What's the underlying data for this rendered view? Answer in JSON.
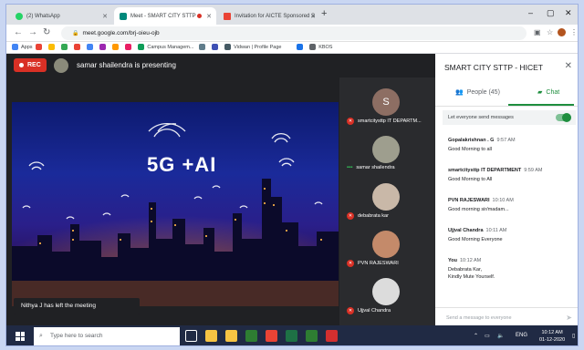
{
  "browser": {
    "tabs": [
      {
        "label": "(2) WhatsApp",
        "color": "#25d366"
      },
      {
        "label": "Meet - SMART CITY STTP - ",
        "color": "#00897b"
      },
      {
        "label": "Invitation for AICTE Sponsored S",
        "color": "#ea4335"
      }
    ],
    "new_tab": "+",
    "window_buttons": [
      "–",
      "▢",
      "✕"
    ],
    "url": "meet.google.com/brj-oieu-ojb",
    "bookmarks": [
      {
        "label": "Apps",
        "color": "#4285f4"
      },
      {
        "label": "",
        "color": "#ea4335"
      },
      {
        "label": "",
        "color": "#fbbc04"
      },
      {
        "label": "",
        "color": "#34a853"
      },
      {
        "label": "",
        "color": "#ea4335"
      },
      {
        "label": "",
        "color": "#4285f4"
      },
      {
        "label": "",
        "color": "#9c27b0"
      },
      {
        "label": "",
        "color": "#ff9800"
      },
      {
        "label": "",
        "color": "#e91e63"
      },
      {
        "label": "Campus Managem...",
        "color": "#0f9d58"
      },
      {
        "label": "",
        "color": "#607d8b"
      },
      {
        "label": "",
        "color": "#3f51b5"
      },
      {
        "label": "Vidwan | Profile Page",
        "color": "#455a64"
      },
      {
        "label": "",
        "color": "#1a73e8"
      },
      {
        "label": "KBOS",
        "color": "#5f6368"
      }
    ]
  },
  "meet": {
    "rec_label": "REC",
    "presenting": "samar shailendra is presenting",
    "stage_text": "5G +AI",
    "toast": "Nithya J has left the meeting",
    "participants": [
      {
        "name": "smartcitysttp IT DEPARTM...",
        "initial": "S",
        "avatar_color": "#8d6e63",
        "muted": true
      },
      {
        "name": "samar shailendra",
        "initial": "",
        "avatar_color": "#9e9e8e",
        "muted": false
      },
      {
        "name": "debabrata kar",
        "initial": "",
        "avatar_color": "#c9b8a8",
        "muted": true
      },
      {
        "name": "PVN RAJESWARI",
        "initial": "",
        "avatar_color": "#c48a6a",
        "muted": true
      },
      {
        "name": "Ujjval Chandra",
        "initial": "",
        "avatar_color": "#dcdcdc",
        "muted": true
      }
    ]
  },
  "panel": {
    "title": "SMART CITY STTP - HICET",
    "people_tab": "People (45)",
    "chat_tab": "Chat",
    "everyone_label": "Let everyone send messages",
    "messages": [
      {
        "sender": "Gopalakrishnan . G",
        "time": "9:57 AM",
        "lines": [
          "Good Morning to all"
        ]
      },
      {
        "sender": "smartcitysttp IT DEPARTMENT",
        "time": "9:59 AM",
        "lines": [
          "Good Morning to All"
        ]
      },
      {
        "sender": "PVN RAJESWARI",
        "time": "10:10 AM",
        "lines": [
          "Good morning sir/madam..."
        ]
      },
      {
        "sender": "Ujjval Chandra",
        "time": "10:11 AM",
        "lines": [
          "Good Morning Everyone"
        ]
      },
      {
        "sender": "You",
        "time": "10:12 AM",
        "lines": [
          "Debabrata Kar,",
          "Kindly Mute Yourself."
        ]
      }
    ],
    "send_placeholder": "Send a message to everyone"
  },
  "taskbar": {
    "search_placeholder": "Type here to search",
    "icons": [
      {
        "name": "task-view-icon",
        "color": "#ffffff"
      },
      {
        "name": "file-explorer-icon",
        "color": "#f6c343"
      },
      {
        "name": "folder-icon",
        "color": "#f6c343"
      },
      {
        "name": "store-icon",
        "color": "#2e7d32"
      },
      {
        "name": "chrome-icon",
        "color": "#ea4335"
      },
      {
        "name": "excel-icon",
        "color": "#1e7145"
      },
      {
        "name": "sticky-notes-icon",
        "color": "#2e7d32"
      },
      {
        "name": "pdf-icon",
        "color": "#d32f2f"
      }
    ],
    "lang": "ENG",
    "time": "10:12 AM",
    "date": "01-12-2020"
  }
}
